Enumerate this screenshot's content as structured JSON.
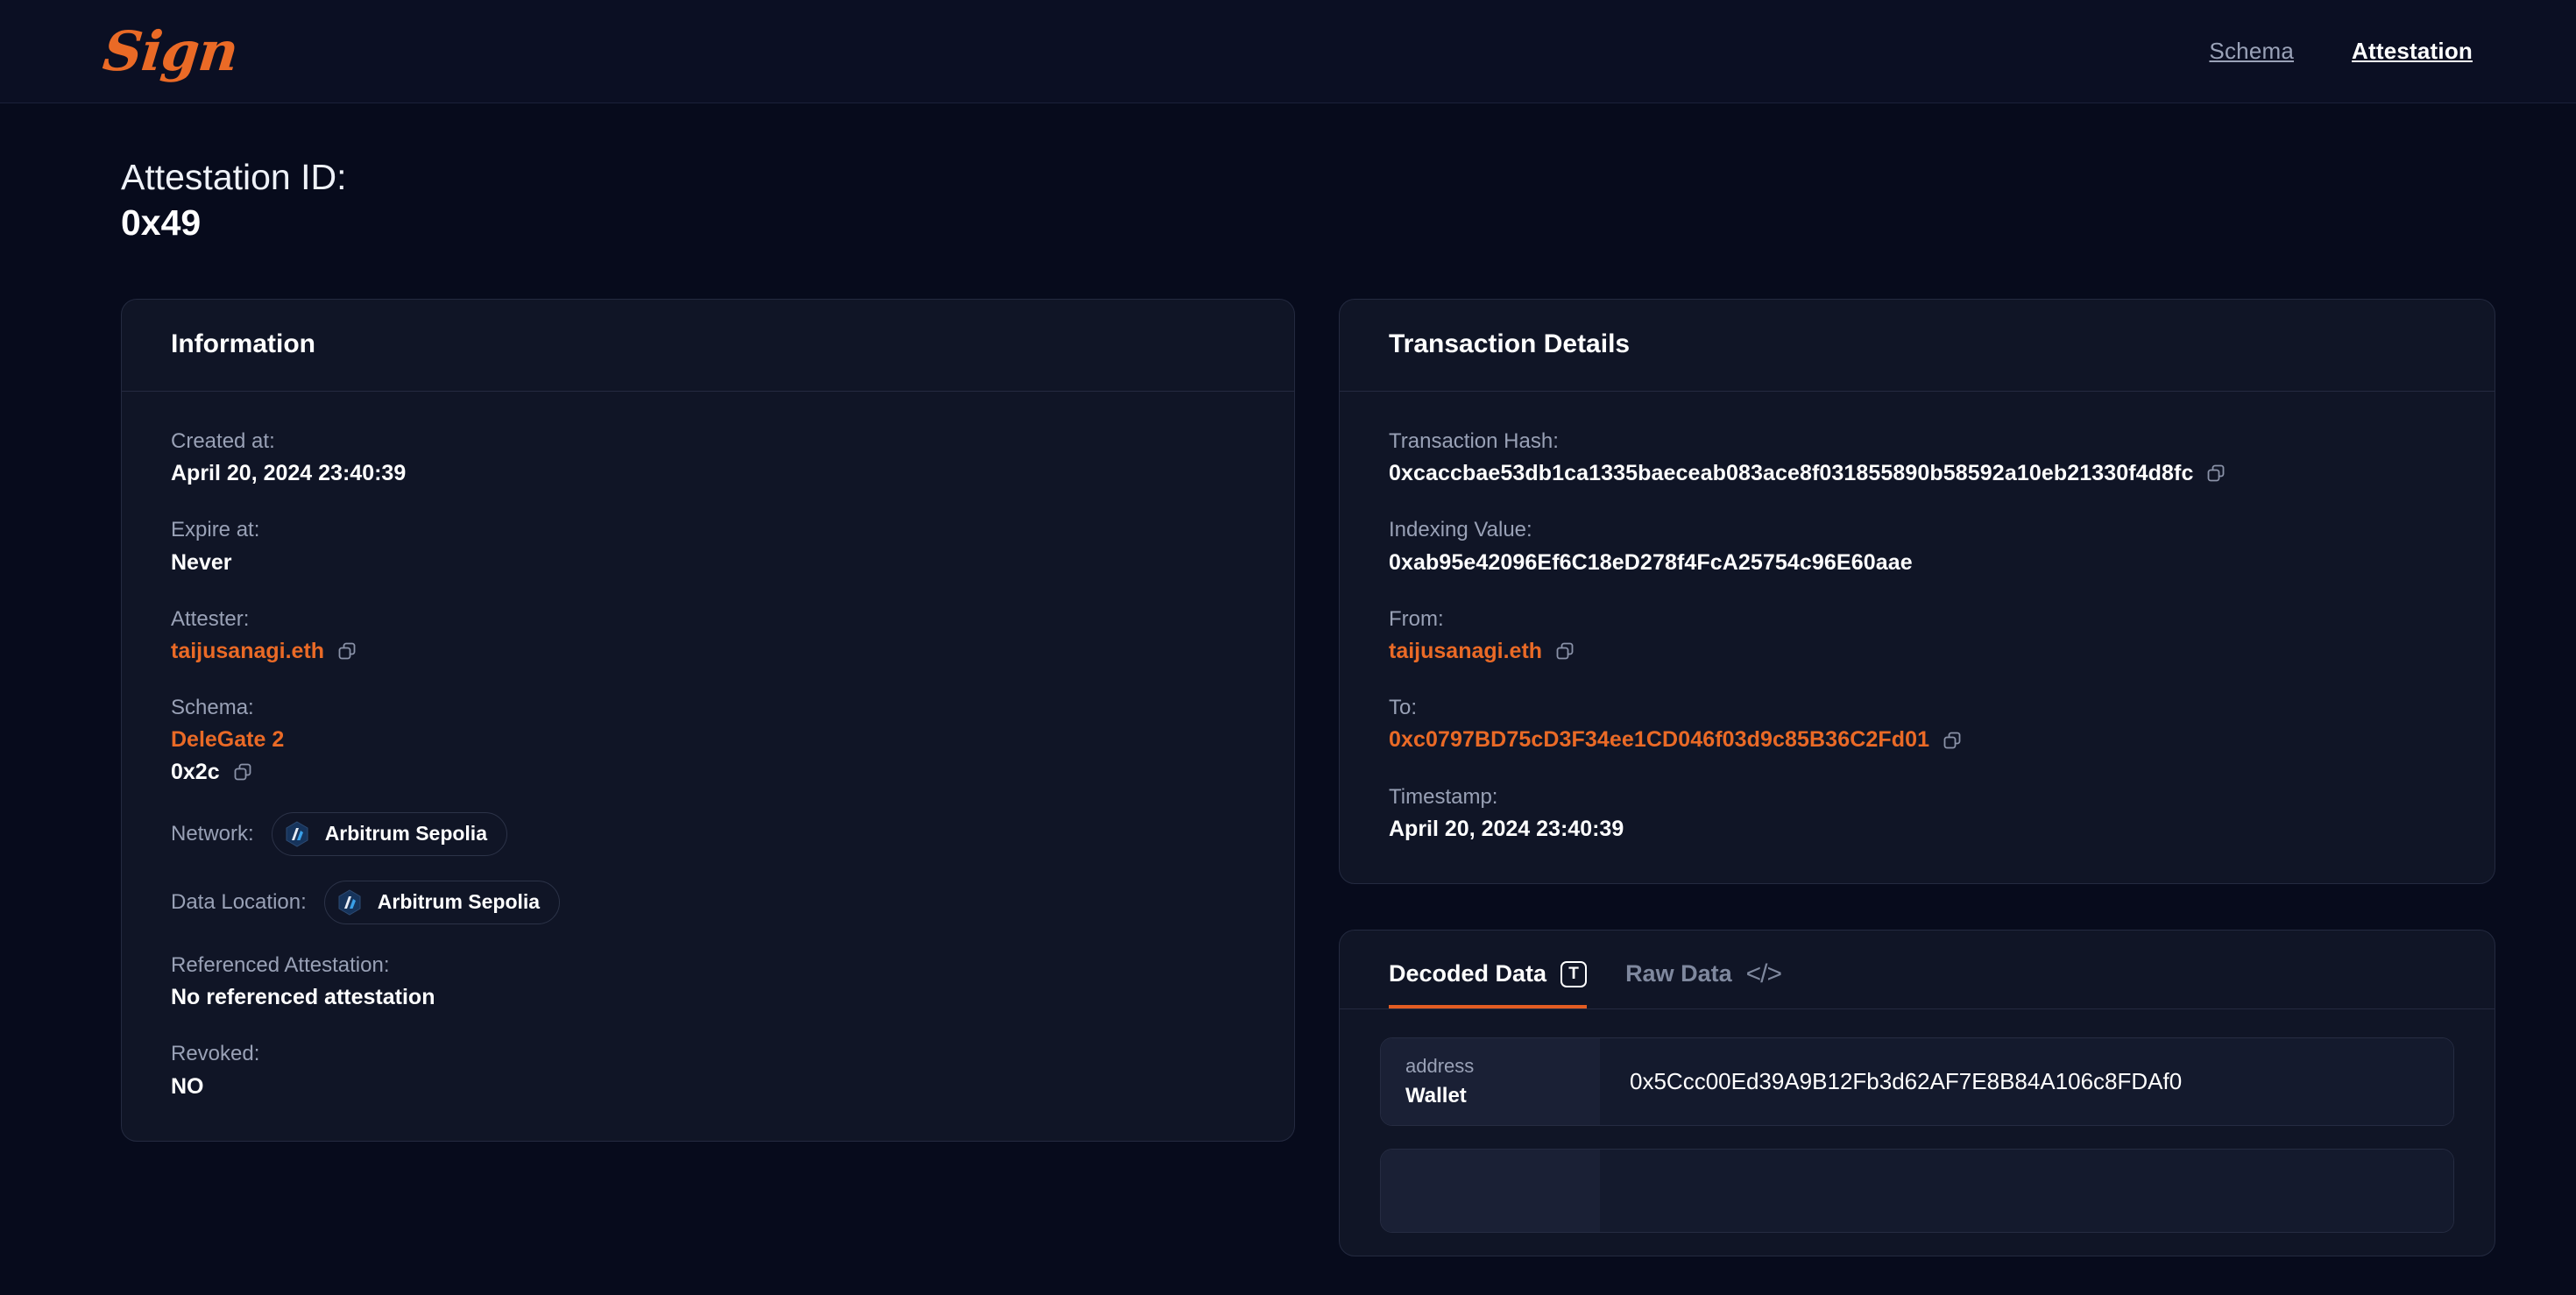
{
  "header": {
    "logo_text": "Sign",
    "nav": [
      {
        "label": "Schema",
        "active": false
      },
      {
        "label": "Attestation",
        "active": true
      }
    ]
  },
  "page": {
    "title_label": "Attestation ID:",
    "title_value": "0x49"
  },
  "information": {
    "card_title": "Information",
    "created_at_label": "Created at:",
    "created_at_value": "April 20, 2024 23:40:39",
    "expire_at_label": "Expire at:",
    "expire_at_value": "Never",
    "attester_label": "Attester:",
    "attester_value": "taijusanagi.eth",
    "schema_label": "Schema:",
    "schema_name": "DeleGate 2",
    "schema_id": "0x2c",
    "network_label": "Network:",
    "network_value": "Arbitrum Sepolia",
    "data_location_label": "Data Location:",
    "data_location_value": "Arbitrum Sepolia",
    "referenced_attestation_label": "Referenced Attestation:",
    "referenced_attestation_value": "No referenced attestation",
    "revoked_label": "Revoked:",
    "revoked_value": "NO"
  },
  "transaction": {
    "card_title": "Transaction Details",
    "tx_hash_label": "Transaction Hash:",
    "tx_hash_value": "0xcaccbae53db1ca1335baeceab083ace8f031855890b58592a10eb21330f4d8fc",
    "indexing_value_label": "Indexing Value:",
    "indexing_value_value": "0xab95e42096Ef6C18eD278f4FcA25754c96E60aae",
    "from_label": "From:",
    "from_value": "taijusanagi.eth",
    "to_label": "To:",
    "to_value": "0xc0797BD75cD3F34ee1CD046f03d9c85B36C2Fd01",
    "timestamp_label": "Timestamp:",
    "timestamp_value": "April 20, 2024 23:40:39"
  },
  "data_panel": {
    "tabs": [
      {
        "label": "Decoded Data",
        "icon": "text-box-icon",
        "active": true
      },
      {
        "label": "Raw Data",
        "icon": "code-brackets-icon",
        "active": false
      }
    ],
    "tab_icon_letter": "T",
    "code_icon_glyph": "</>",
    "rows": [
      {
        "type": "address",
        "name": "Wallet",
        "value": "0x5Ccc00Ed39A9B12Fb3d62AF7E8B84A106c8FDAf0"
      },
      {
        "type": "",
        "name": "",
        "value": ""
      }
    ]
  },
  "icons": {
    "copy": "copy-icon",
    "chain": "arbitrum-logo-icon"
  },
  "colors": {
    "accent": "#ea6a26",
    "tab_underline": "#e25c22",
    "page_bg": "#070b1c",
    "card_bg": "#101526",
    "nav_bg": "#0b0f23",
    "muted_text": "#99a1b6",
    "chain_blue": "#2d99e0"
  }
}
